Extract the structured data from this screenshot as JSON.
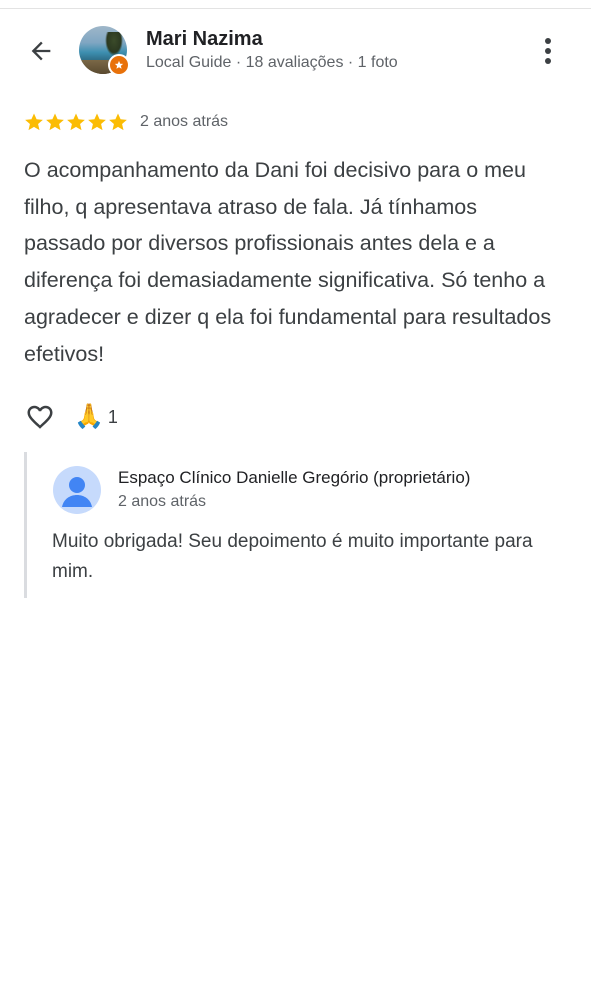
{
  "reviewer": {
    "name": "Mari Nazima",
    "meta": "Local Guide · 18 avaliações · 1 foto"
  },
  "review": {
    "rating": 5,
    "time": "2 anos atrás",
    "text": "O acompanhamento da Dani foi decisivo para o meu filho, q apresentava atraso de fala. Já tínhamos passado por diversos profissionais antes dela e a diferença foi demasiadamente significativa. Só tenho a agradecer e dizer q ela foi fundamental para resultados efetivos!"
  },
  "reactions": {
    "like_icon": "heart-outline-icon",
    "emoji": "🙏",
    "count": "1"
  },
  "owner_reply": {
    "name": "Espaço Clínico Danielle Gregório (proprietário)",
    "time": "2 anos atrás",
    "text": "Muito obrigada! Seu depoimento é muito importante para mim."
  },
  "colors": {
    "star": "#fbbc04",
    "secondary_text": "#5f6368",
    "body_text": "#3c4043",
    "badge": "#e8710a",
    "reply_border": "#dadce0"
  }
}
